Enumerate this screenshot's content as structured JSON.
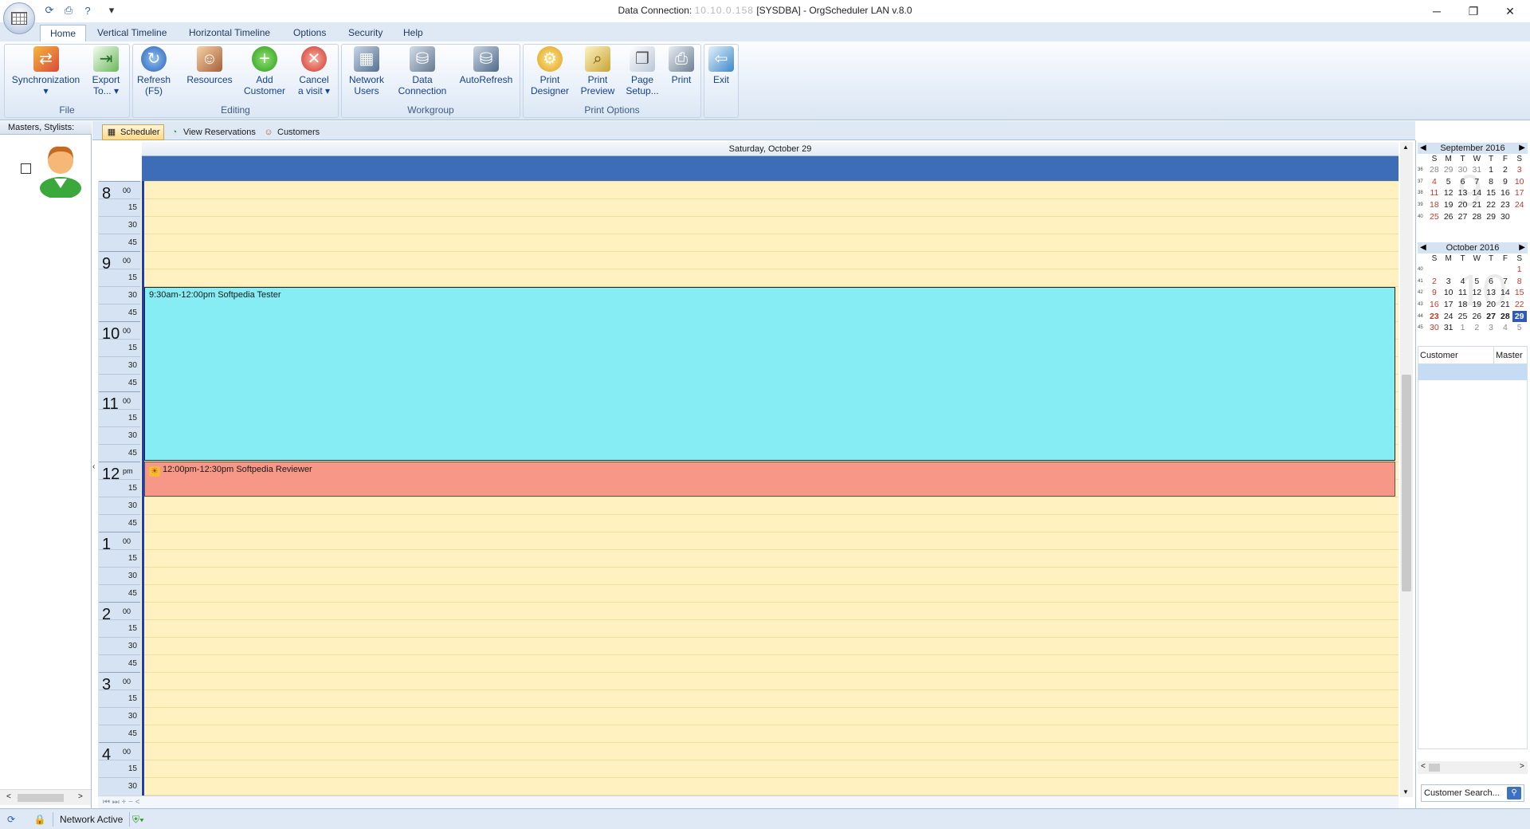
{
  "window": {
    "title_prefix": "Data Connection:",
    "title_hidden": "10.10.0.158",
    "title_suffix": "[SYSDBA] - OrgScheduler LAN v.8.0",
    "controls": {
      "minimize": "─",
      "restore": "❐",
      "close": "✕"
    }
  },
  "quick_access": {
    "dropdown": "▾"
  },
  "menu_tabs": [
    "Home",
    "Vertical Timeline",
    "Horizontal Timeline",
    "Options",
    "Security",
    "Help"
  ],
  "ribbon": {
    "groups": {
      "file": "File",
      "editing": "Editing",
      "workgroup": "Workgroup",
      "print_options": "Print Options"
    },
    "buttons": {
      "sync": [
        "Synchronization",
        "▾"
      ],
      "export": [
        "Export",
        "To... ▾"
      ],
      "refresh": [
        "Refresh",
        "(F5)"
      ],
      "resources": [
        "Resources",
        ""
      ],
      "add_customer": [
        "Add",
        "Customer"
      ],
      "cancel_visit": [
        "Cancel",
        "a visit ▾"
      ],
      "network_users": [
        "Network",
        "Users"
      ],
      "data_connection": [
        "Data",
        "Connection"
      ],
      "autorefresh": [
        "AutoRefresh",
        ""
      ],
      "print_designer": [
        "Print",
        "Designer"
      ],
      "print_preview": [
        "Print",
        "Preview"
      ],
      "page_setup": [
        "Page",
        "Setup..."
      ],
      "print": [
        "Print",
        ""
      ],
      "exit": [
        "Exit",
        ""
      ]
    }
  },
  "left_panel": {
    "title": "Masters, Stylists:",
    "scroll_left": "<",
    "scroll_right": ">"
  },
  "view_tabs": [
    "Scheduler",
    "View Reservations",
    "Customers"
  ],
  "scheduler": {
    "day_header": "Saturday, October 29",
    "appointments": [
      {
        "label": "9:30am-12:00pm Softpedia Tester",
        "color": "#86edf5"
      },
      {
        "label": "12:00pm-12:30pm Softpedia Reviewer",
        "color": "#f79787"
      }
    ],
    "hours": [
      {
        "h": "8",
        "ap": "00"
      },
      {
        "h": "9",
        "ap": "00"
      },
      {
        "h": "10",
        "ap": "00"
      },
      {
        "h": "11",
        "ap": "00"
      },
      {
        "h": "12",
        "ap": "pm"
      },
      {
        "h": "1",
        "ap": "00"
      },
      {
        "h": "2",
        "ap": "00"
      },
      {
        "h": "3",
        "ap": "00"
      },
      {
        "h": "4",
        "ap": "00"
      }
    ],
    "minutes": [
      "15",
      "30",
      "45"
    ],
    "scroll_up": "▲",
    "scroll_down": "▼",
    "nav_text": "⏮ ⏭ + − <"
  },
  "mini_calendars": [
    {
      "title": "September 2016",
      "dow": [
        "S",
        "M",
        "T",
        "W",
        "T",
        "F",
        "S"
      ],
      "ghost": "9",
      "weeks": [
        {
          "wk": "36",
          "days": [
            "28",
            "29",
            "30",
            "31",
            "1",
            "2",
            "3"
          ]
        },
        {
          "wk": "37",
          "days": [
            "4",
            "5",
            "6",
            "7",
            "8",
            "9",
            "10"
          ]
        },
        {
          "wk": "38",
          "days": [
            "11",
            "12",
            "13",
            "14",
            "15",
            "16",
            "17"
          ]
        },
        {
          "wk": "39",
          "days": [
            "18",
            "19",
            "20",
            "21",
            "22",
            "23",
            "24"
          ]
        },
        {
          "wk": "40",
          "days": [
            "25",
            "26",
            "27",
            "28",
            "29",
            "30",
            ""
          ]
        }
      ]
    },
    {
      "title": "October 2016",
      "dow": [
        "S",
        "M",
        "T",
        "W",
        "T",
        "F",
        "S"
      ],
      "ghost": "10",
      "weeks": [
        {
          "wk": "40",
          "days": [
            "",
            "",
            "",
            "",
            "",
            "",
            "1"
          ]
        },
        {
          "wk": "41",
          "days": [
            "2",
            "3",
            "4",
            "5",
            "6",
            "7",
            "8"
          ]
        },
        {
          "wk": "42",
          "days": [
            "9",
            "10",
            "11",
            "12",
            "13",
            "14",
            "15"
          ]
        },
        {
          "wk": "43",
          "days": [
            "16",
            "17",
            "18",
            "19",
            "20",
            "21",
            "22"
          ]
        },
        {
          "wk": "44",
          "days": [
            "23",
            "24",
            "25",
            "26",
            "27",
            "28",
            "29"
          ]
        },
        {
          "wk": "45",
          "days": [
            "30",
            "31",
            "1",
            "2",
            "3",
            "4",
            "5"
          ]
        }
      ]
    }
  ],
  "customer_grid": {
    "columns": [
      "Customer",
      "Master"
    ]
  },
  "customer_search": {
    "placeholder": "Customer Search..."
  },
  "statusbar": {
    "network": "Network Active"
  }
}
